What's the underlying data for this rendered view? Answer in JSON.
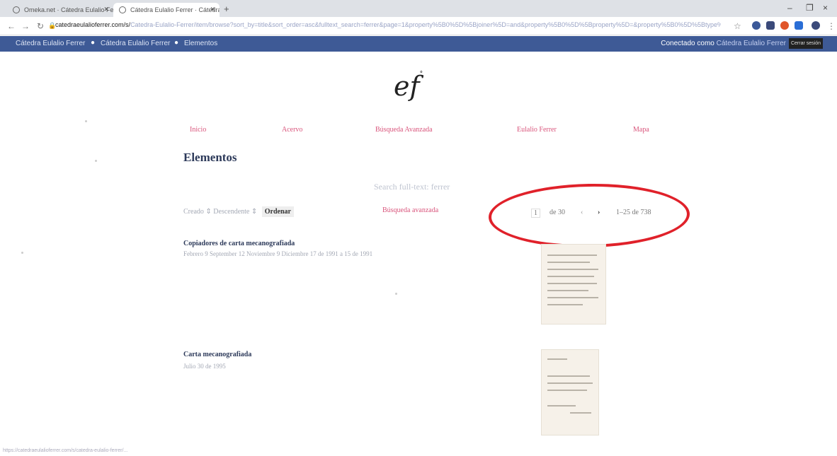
{
  "browser": {
    "tabs": [
      {
        "label": "Omeka.net · Cátedra Eulalio Ferr..."
      },
      {
        "label": "Cátedra Eulalio Ferrer · Cátedra..."
      }
    ],
    "new_tab": "+",
    "window_controls": {
      "minimize": "–",
      "restore": "❐",
      "close": "×"
    },
    "url_host": "catedraeulalioferrer.com/s/",
    "url_path": "Catedra-Eulalio-Ferrer/item/browse?sort_by=title&sort_order=asc&fulltext_search=ferrer&page=1&property%5B0%5D%5Bjoiner%5D=and&property%5B0%5D%5Bproperty%5D=&property%5B0%5D%5Btype%5D=eq&property%5B0%5D%5Btext%5D=&resource_class_id%5B%5D=&item_set_id%5B%5D=&site_id=&submit=Search..."
  },
  "admin_bar": {
    "crumb1": "Cátedra Eulalio Ferrer",
    "crumb2": "Cátedra Eulalio Ferrer",
    "crumb3": "Elementos",
    "connected_prefix": "Conectado como",
    "user": "Cátedra Eulalio Ferrer",
    "logout": "Cerrar sesión"
  },
  "site": {
    "logo": "ef",
    "nav": [
      "Inicio",
      "Acervo",
      "Búsqueda Avanzada",
      "Eulalio Ferrer",
      "Mapa"
    ],
    "page_title": "Elementos",
    "search_text": "Search full-text: ferrer",
    "sort": {
      "by": "Creado",
      "order": "Descendente",
      "button": "Ordenar"
    },
    "advanced_link": "Búsqueda avanzada",
    "pager": {
      "page": "1",
      "of": "de 30",
      "range": "1–25 de 738"
    }
  },
  "items": [
    {
      "title": "Copiadores de carta mecanografiada",
      "date": "Febrero 9 September 12 Noviembre 9 Diciembre 17 de 1991 a 15 de 1991"
    },
    {
      "title": "Carta mecanografiada",
      "date": "Julio 30 de 1995"
    }
  ],
  "status_bar": "https://catedraeulalioferrer.com/s/catedra-eulalio-ferrer/..."
}
